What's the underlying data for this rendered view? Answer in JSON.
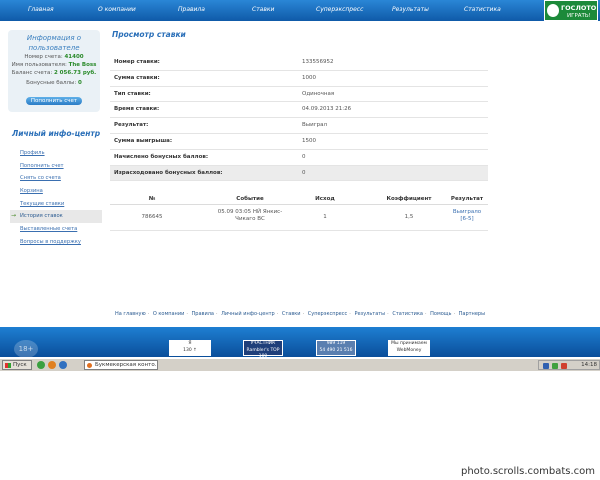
{
  "nav": {
    "items": [
      "Главная",
      "О компании",
      "Правила",
      "Ставки",
      "Суперэкспресс",
      "Результаты",
      "Статистика"
    ],
    "logo_line1": "ГОСЛОТО",
    "logo_line2": "ИГРАТЬ!"
  },
  "userbox": {
    "title": "Информация о пользователе",
    "account_label": "Номер счета:",
    "account_value": "41400",
    "username_label": "Имя пользователя:",
    "username_value": "The Boss",
    "balance_label": "Баланс счета:",
    "balance_value": "2 056.73 руб.",
    "bonus_label": "Бонусные баллы:",
    "bonus_value": "0",
    "topup_button": "Пополнить счет"
  },
  "sidebar": {
    "title": "Личный инфо-центр",
    "items": [
      "Профиль",
      "Пополнить счет",
      "Снять со счета",
      "Корзина",
      "Текущие ставки",
      "История ставок",
      "Выставленные счета",
      "Вопросы в поддержку"
    ],
    "active_index": 5
  },
  "page_title": "Просмотр ставки",
  "details": [
    {
      "label": "Номер ставки:",
      "value": "133556952"
    },
    {
      "label": "Сумма ставки:",
      "value": "1000"
    },
    {
      "label": "Тип ставки:",
      "value": "Одиночная"
    },
    {
      "label": "Время ставки:",
      "value": "04.09.2013 21:26"
    },
    {
      "label": "Результат:",
      "value": "Выиграл"
    },
    {
      "label": "Сумма выигрыша:",
      "value": "1500"
    },
    {
      "label": "Начислено бонусных баллов:",
      "value": "0"
    },
    {
      "label": "Израсходовано бонусных баллов:",
      "value": "0"
    }
  ],
  "bets_table": {
    "headers": [
      "№",
      "Событие",
      "Исход",
      "Коэффициент",
      "Результат"
    ],
    "rows": [
      {
        "num": "786645",
        "event_line1": "05.09 03:05  НЙ Янкис-",
        "event_line2": "Чикаго ВС",
        "outcome": "1",
        "coef": "1,5",
        "result_line1": "Выиграло",
        "result_line2": "[6-5]"
      }
    ]
  },
  "footer_links": [
    "На главную",
    "О компании",
    "Правила",
    "Личный инфо-центр",
    "Ставки",
    "Суперэкспресс",
    "Результаты",
    "Статистика",
    "Помощь",
    "Партнеры"
  ],
  "banner": {
    "age": "18+",
    "badges": [
      {
        "l1": "Я",
        "l2": "130 ↑"
      },
      {
        "l1": "УЧАСТНИК",
        "l2": "Rambler's TOP 100"
      },
      {
        "l1": "989 119",
        "l2": "54 490  21 516"
      },
      {
        "l1": "Мы принимаем",
        "l2": "WebMoney"
      }
    ]
  },
  "taskbar": {
    "start": "Пуск",
    "task": "Букмекерская конто...",
    "clock": "14:18"
  },
  "watermark": "photo.scrolls.combats.com"
}
